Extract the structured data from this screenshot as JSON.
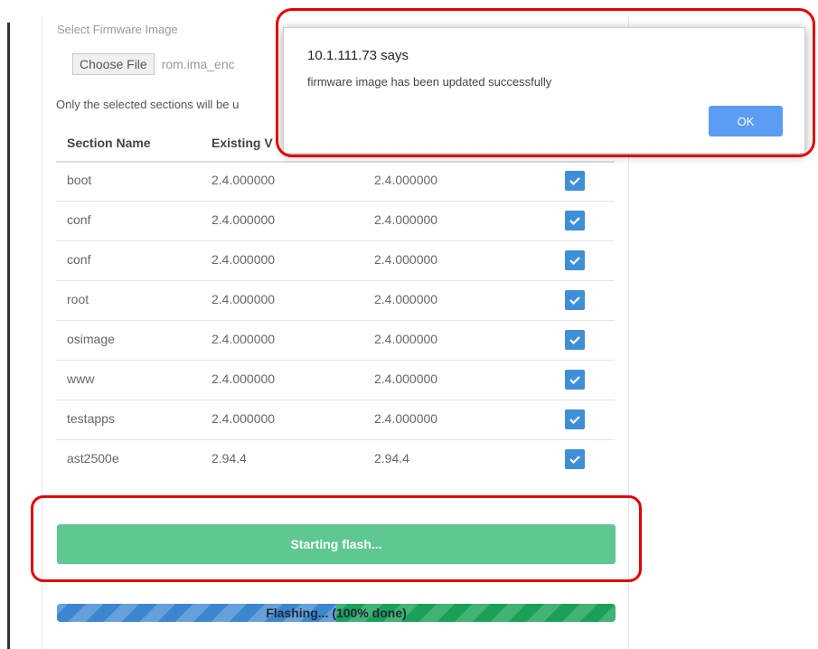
{
  "firmware": {
    "label": "Select Firmware Image",
    "choose_button": "Choose File",
    "file_name": "rom.ima_enc"
  },
  "sections_note": "Only the selected sections will be u",
  "table": {
    "headers": [
      "Section Name",
      "Existing V",
      "",
      ""
    ],
    "rows": [
      {
        "name": "boot",
        "existing": "2.4.000000",
        "new": "2.4.000000",
        "checked": true
      },
      {
        "name": "conf",
        "existing": "2.4.000000",
        "new": "2.4.000000",
        "checked": true
      },
      {
        "name": "conf",
        "existing": "2.4.000000",
        "new": "2.4.000000",
        "checked": true
      },
      {
        "name": "root",
        "existing": "2.4.000000",
        "new": "2.4.000000",
        "checked": true
      },
      {
        "name": "osimage",
        "existing": "2.4.000000",
        "new": "2.4.000000",
        "checked": true
      },
      {
        "name": "www",
        "existing": "2.4.000000",
        "new": "2.4.000000",
        "checked": true
      },
      {
        "name": "testapps",
        "existing": "2.4.000000",
        "new": "2.4.000000",
        "checked": true
      },
      {
        "name": "ast2500e",
        "existing": "2.94.4",
        "new": "2.94.4",
        "checked": true
      }
    ]
  },
  "flash_button": "Starting flash...",
  "progress": {
    "text": "Flashing... (100% done)",
    "percent": 100
  },
  "dialog": {
    "title": "10.1.111.73 says",
    "message": "firmware image has been updated successfully",
    "ok_label": "OK"
  },
  "colors": {
    "checkbox": "#3f8fd6",
    "flash_button": "#5fc791",
    "ok_button": "#5b9df5",
    "highlight": "#e00000"
  }
}
